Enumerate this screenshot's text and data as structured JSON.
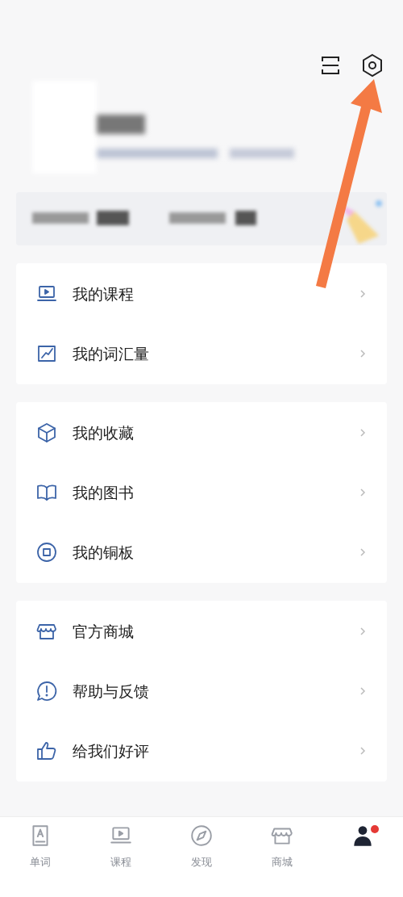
{
  "groups": [
    {
      "items": [
        {
          "kind": "course",
          "label": "我的课程"
        },
        {
          "kind": "chart",
          "label": "我的词汇量"
        }
      ]
    },
    {
      "items": [
        {
          "kind": "cube",
          "label": "我的收藏"
        },
        {
          "kind": "book",
          "label": "我的图书"
        },
        {
          "kind": "coin",
          "label": "我的铜板"
        }
      ]
    },
    {
      "items": [
        {
          "kind": "store",
          "label": "官方商城"
        },
        {
          "kind": "help",
          "label": "帮助与反馈"
        },
        {
          "kind": "like",
          "label": "给我们好评"
        }
      ]
    }
  ],
  "tabs": [
    {
      "kind": "word",
      "label": "单词",
      "selected": false,
      "badge": false
    },
    {
      "kind": "course",
      "label": "课程",
      "selected": false,
      "badge": false
    },
    {
      "kind": "compass",
      "label": "发现",
      "selected": false,
      "badge": false
    },
    {
      "kind": "store",
      "label": "商城",
      "selected": false,
      "badge": false
    },
    {
      "kind": "person",
      "selected": true,
      "badge": true
    }
  ]
}
